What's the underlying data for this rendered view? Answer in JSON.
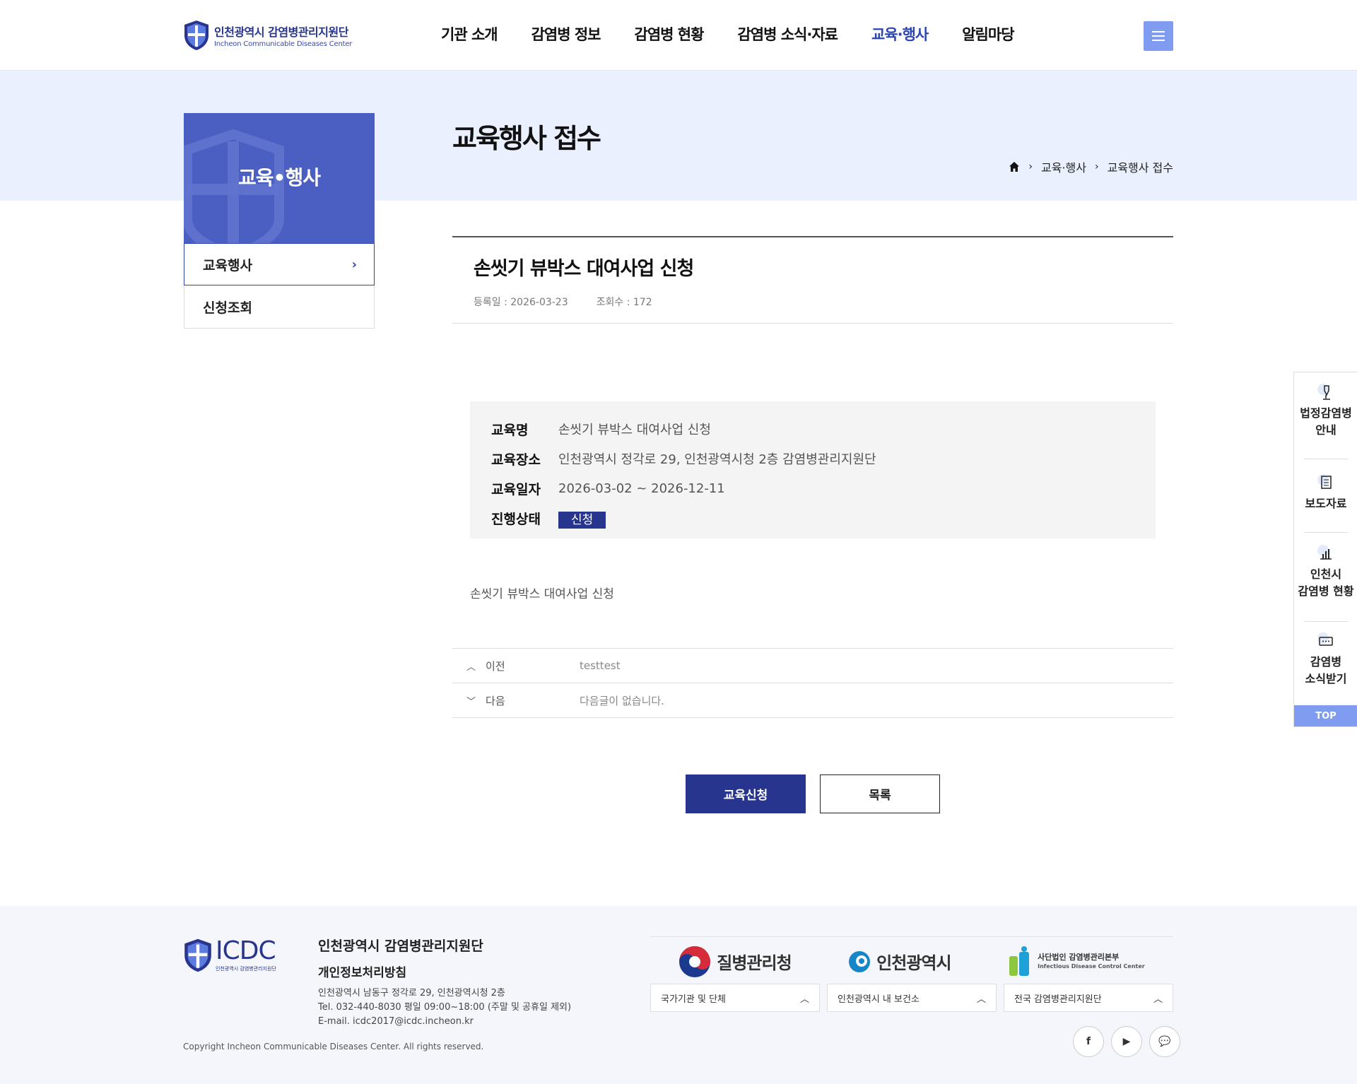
{
  "header": {
    "logo_ko": "인천광역시 감염병관리지원단",
    "logo_en": "Incheon Communicable Diseases Center",
    "nav": [
      "기관 소개",
      "감염병 정보",
      "감염병 현황",
      "감염병 소식·자료",
      "교육·행사",
      "알림마당"
    ],
    "active_nav": "교육·행사",
    "menu_icon": "hamburger-icon"
  },
  "side": {
    "title": "교육•행사",
    "items": [
      {
        "label": "교육행사",
        "active": true
      },
      {
        "label": "신청조회",
        "active": false
      }
    ]
  },
  "page": {
    "title": "교육행사 접수",
    "breadcrumb": [
      "교육·행사",
      "교육행사 접수"
    ]
  },
  "post": {
    "title": "손씻기 뷰박스 대여사업 신청",
    "date": "등록일 : 2026-03-23",
    "views": "조회수 : 172",
    "info": [
      {
        "label": "교육명",
        "value": "손씻기 뷰박스 대여사업 신청"
      },
      {
        "label": "교육장소",
        "value": "인천광역시 정각로 29, 인천광역시청 2층 감염병관리지원단"
      },
      {
        "label": "교육일자",
        "value": "2026-03-02 ~ 2026-12-11"
      },
      {
        "label": "진행상태",
        "value": "신청"
      }
    ],
    "content": "손씻기 뷰박스 대여사업 신청",
    "prev_label": "이전",
    "prev_text": "testtest",
    "next_label": "다음",
    "next_text": "다음글이 없습니다."
  },
  "buttons": {
    "apply": "교육신청",
    "list": "목록"
  },
  "quick": {
    "items": [
      "법정감염병 안내",
      "보도자료",
      "인천시 감염병 현황",
      "감염병 소식받기"
    ],
    "top": "TOP"
  },
  "footer": {
    "logo": "ICDC",
    "logo_small": "인천광역시 감염병관리지원단",
    "org": "인천광역시 감염병관리지원단",
    "privacy": "개인정보처리방침",
    "address": "인천광역시 남동구 정각로 29, 인천광역시청 2층",
    "tel": "Tel. 032-440-8030 평일 09:00~18:00 (주말 및 공휴일 제외)",
    "email": "E-mail. icdc2017@icdc.incheon.kr",
    "copyright": "Copyright Incheon Communicable Diseases Center. All rights reserved.",
    "partners": [
      "질병관리청",
      "인천광역시",
      "사단법인 감염병관리본부",
      "Infectious Disease Control Center"
    ],
    "selects": [
      "국가기관 및 단체",
      "인천광역시 내 보건소",
      "전국 감염병관리지원단"
    ],
    "social": [
      "f",
      "▶",
      "💬"
    ]
  },
  "colors": {
    "primary": "#27358f",
    "accent": "#2b46b4",
    "light_blue": "#7f9cf0",
    "banner_bg": "#eaf0fd"
  }
}
